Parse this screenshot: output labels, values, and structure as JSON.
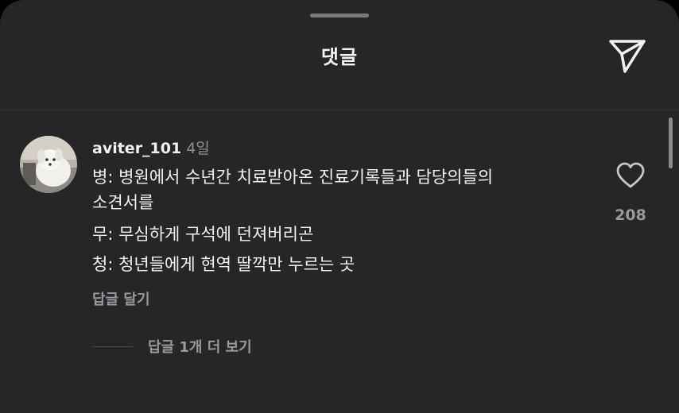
{
  "header": {
    "title": "댓글",
    "send_icon": "send-icon"
  },
  "comment": {
    "username": "aviter_101",
    "time": "4일",
    "lines": [
      "병: 병원에서 수년간 치료받아온 진료기록들과 담당의들의",
      "소견서를",
      "무: 무심하게 구석에 던져버리곤",
      "청: 청년들에게 현역 딸깍만 누르는 곳"
    ],
    "reply_label": "답글 달기",
    "like_count": "208",
    "like_icon": "heart-icon"
  },
  "replies": {
    "more_label": "답글 1개 더 보기"
  },
  "colors": {
    "sheet_bg": "#262628",
    "text_primary": "#f2f2f2",
    "text_secondary": "#9a9a9e"
  }
}
